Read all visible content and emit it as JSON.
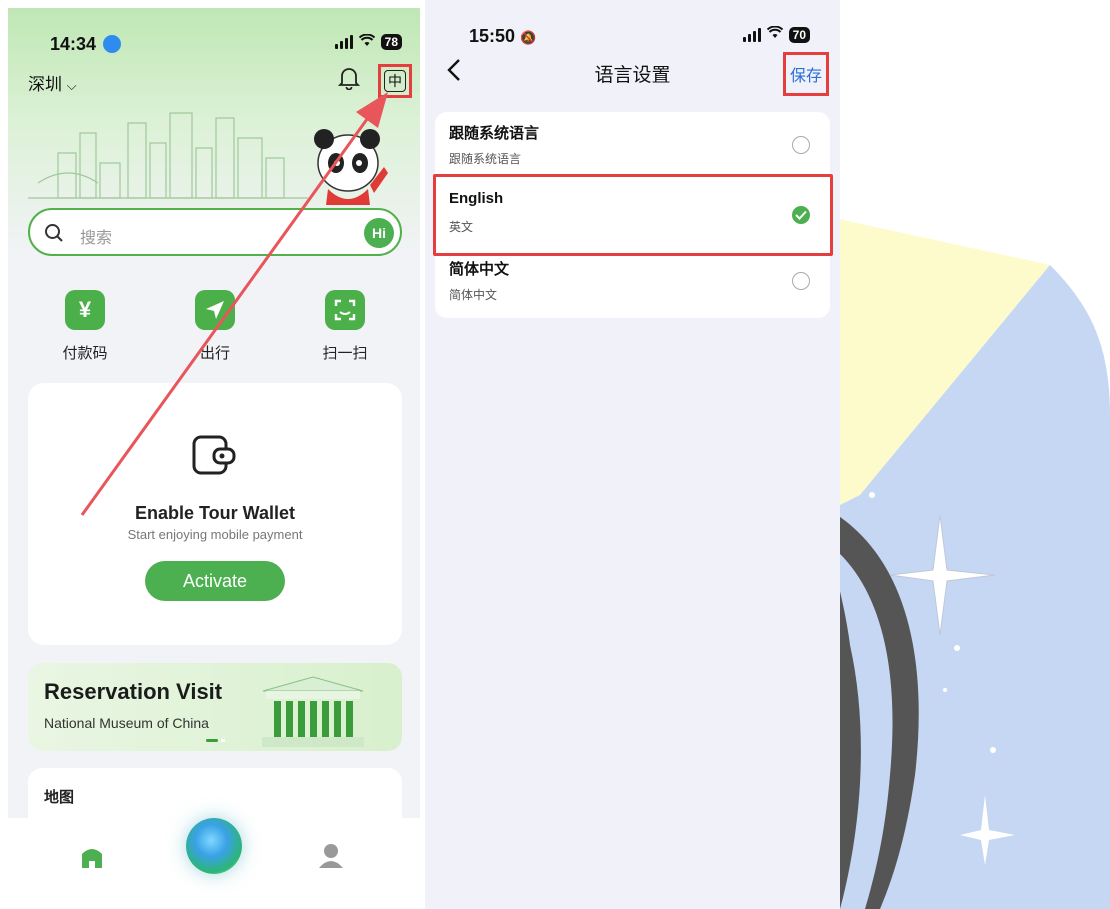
{
  "left_screen": {
    "status_time": "14:34",
    "battery": "78",
    "city": "深圳",
    "lang_toggle": "中",
    "search_placeholder": "搜索",
    "hi_badge": "Hi",
    "quick_actions": [
      {
        "label": "付款码",
        "icon": "yen-icon"
      },
      {
        "label": "出行",
        "icon": "send-icon"
      },
      {
        "label": "扫一扫",
        "icon": "scan-icon"
      }
    ],
    "wallet": {
      "title": "Enable Tour Wallet",
      "subtitle": "Start enjoying mobile payment",
      "button": "Activate"
    },
    "reservation": {
      "title": "Reservation Visit",
      "subtitle": "National Museum of China"
    },
    "map_title": "地图"
  },
  "right_screen": {
    "status_time": "15:50",
    "battery": "70",
    "title": "语言设置",
    "save_label": "保存",
    "languages": [
      {
        "title": "跟随系统语言",
        "subtitle": "跟随系统语言",
        "selected": false
      },
      {
        "title": "English",
        "subtitle": "英文",
        "selected": true
      },
      {
        "title": "简体中文",
        "subtitle": "简体中文",
        "selected": false
      }
    ]
  },
  "colors": {
    "accent_green": "#4caf50",
    "highlight_red": "#e53e3e",
    "save_blue": "#2a6fd8"
  }
}
